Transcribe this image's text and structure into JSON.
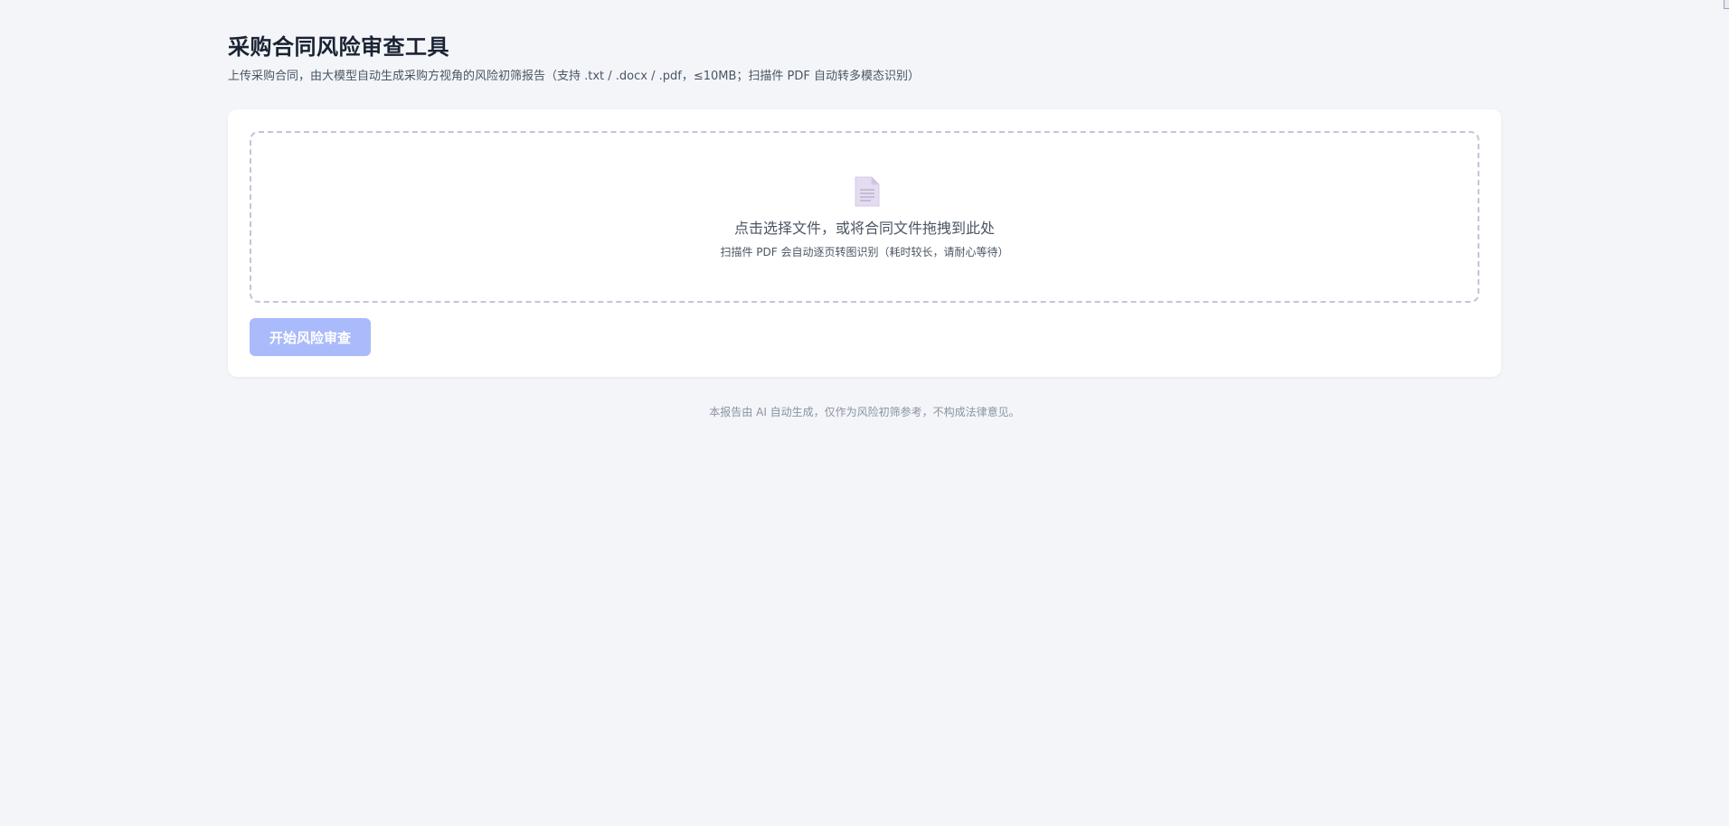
{
  "header": {
    "title": "采购合同风险审查工具",
    "subtitle": "上传采购合同，由大模型自动生成采购方视角的风险初筛报告（支持 .txt / .docx / .pdf，≤10MB；扫描件 PDF 自动转多模态识别）"
  },
  "upload": {
    "icon": "document-icon",
    "title": "点击选择文件，或将合同文件拖拽到此处",
    "hint": "扫描件 PDF 会自动逐页转图识别（耗时较长，请耐心等待）"
  },
  "actions": {
    "start_label": "开始风险审查",
    "start_disabled": true
  },
  "footer": {
    "note": "本报告由 AI 自动生成，仅作为风险初筛参考，不构成法律意见。"
  },
  "colors": {
    "background": "#f3f5f9",
    "card": "#ffffff",
    "button_disabled": "#a9bbfa",
    "dropzone_border": "#c7c3d8",
    "icon_fill": "#e4dcf0"
  }
}
